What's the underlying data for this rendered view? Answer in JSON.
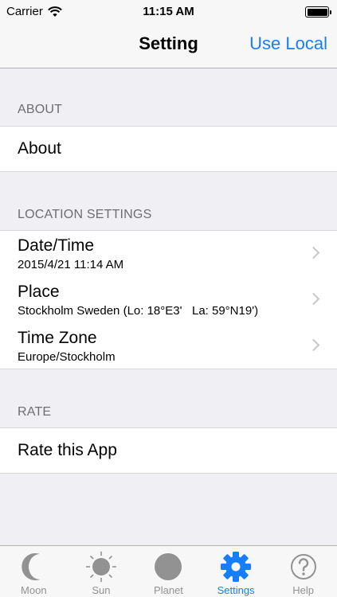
{
  "status_bar": {
    "carrier": "Carrier",
    "time": "11:15 AM"
  },
  "nav": {
    "title": "Setting",
    "action": "Use Local"
  },
  "sections": {
    "about": {
      "header": "ABOUT",
      "rows": [
        {
          "title": "About"
        }
      ]
    },
    "location": {
      "header": "LOCATION SETTINGS",
      "rows": [
        {
          "title": "Date/Time",
          "subtitle": "2015/4/21 11:14 AM"
        },
        {
          "title": "Place",
          "subtitle": "Stockholm Sweden (Lo: 18°E3'   La: 59°N19')"
        },
        {
          "title": "Time Zone",
          "subtitle": "Europe/Stockholm"
        }
      ]
    },
    "rate": {
      "header": "RATE",
      "rows": [
        {
          "title": "Rate this App"
        }
      ]
    }
  },
  "tabs": [
    {
      "label": "Moon",
      "icon": "moon-icon"
    },
    {
      "label": "Sun",
      "icon": "sun-icon"
    },
    {
      "label": "Planet",
      "icon": "planet-icon"
    },
    {
      "label": "Settings",
      "icon": "gear-icon",
      "active": true
    },
    {
      "label": "Help",
      "icon": "help-icon"
    }
  ],
  "colors": {
    "accent": "#157efb",
    "inactive": "#929292",
    "background": "#efeff4"
  }
}
